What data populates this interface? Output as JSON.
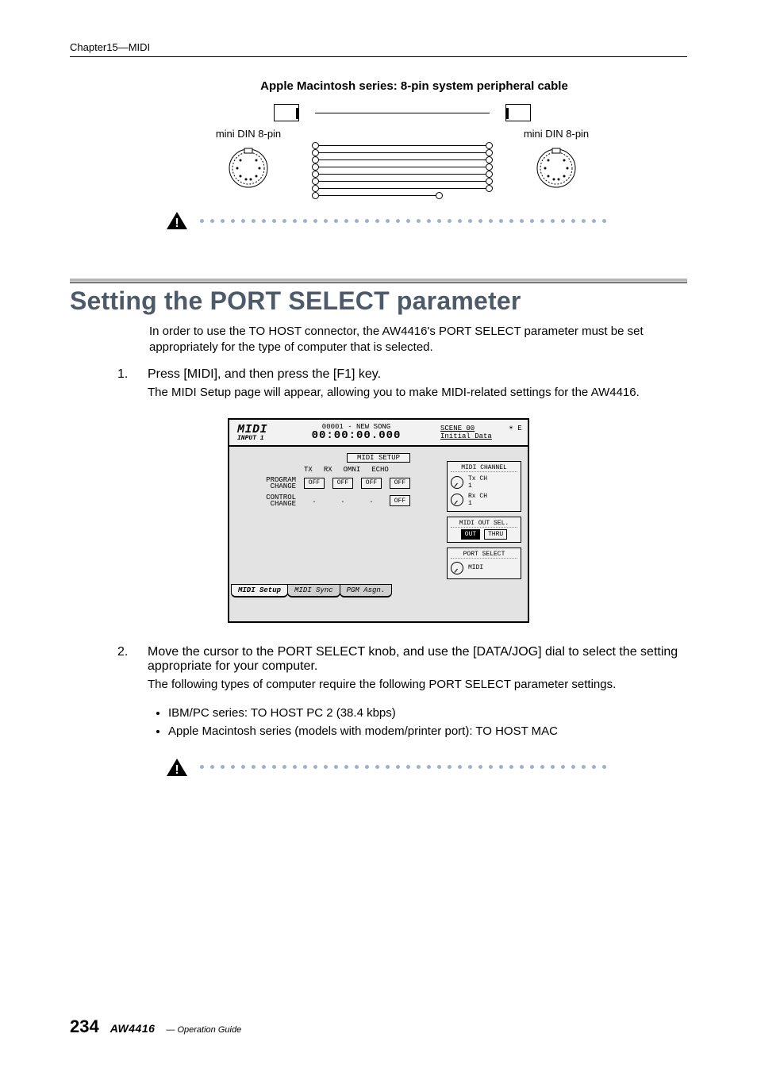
{
  "header": {
    "chapter": "Chapter15—MIDI"
  },
  "cable": {
    "title": "Apple Macintosh series: 8-pin system peripheral cable",
    "left_label": "mini DIN 8-pin",
    "right_label": "mini DIN 8-pin"
  },
  "section": {
    "title": "Setting the PORT SELECT parameter",
    "intro": "In order to use the TO HOST connector, the AW4416's PORT SELECT parameter must be set appropriately for the type of computer that is selected."
  },
  "steps": [
    {
      "num": "1.",
      "title": "Press [MIDI], and then press the [F1] key.",
      "desc": "The MIDI Setup page will appear, allowing you to make MIDI-related settings for the AW4416."
    },
    {
      "num": "2.",
      "title": "Move the cursor to the PORT SELECT knob, and use the [DATA/JOG] dial to select the setting appropriate for your computer.",
      "desc": "The following types of computer require the following PORT SELECT parameter settings.",
      "bullets": [
        "IBM/PC series: TO HOST PC 2 (38.4 kbps)",
        "Apple Macintosh series (models with modem/printer port): TO HOST MAC"
      ]
    }
  ],
  "screenshot": {
    "title_left": "MIDI",
    "title_left_sub": "INPUT 1",
    "song": "00001 - NEW SONG",
    "time": "00:00:00.000",
    "scene": "SCENE 00",
    "scene_right": "E",
    "initial": "Initial Data",
    "setup_label": "MIDI SETUP",
    "cols": [
      "TX",
      "RX",
      "OMNI",
      "ECHO"
    ],
    "rows": [
      {
        "label_lines": [
          "PROGRAM",
          "CHANGE"
        ],
        "cells": [
          "OFF",
          "OFF",
          "OFF",
          "OFF"
        ]
      },
      {
        "label_lines": [
          "CONTROL",
          "CHANGE"
        ],
        "cells": [
          ".",
          ".",
          ".",
          "OFF"
        ]
      }
    ],
    "right": {
      "channel_title": "MIDI CHANNEL",
      "tx": {
        "label": "Tx CH",
        "value": "1"
      },
      "rx": {
        "label": "Rx CH",
        "value": "1"
      },
      "out_sel_title": "MIDI OUT SEL.",
      "out_btn": "OUT",
      "thru_btn": "THRU",
      "port_select_title": "PORT SELECT",
      "port_value": "MIDI"
    },
    "tabs": [
      "MIDI Setup",
      "MIDI Sync",
      "PGM Asgn."
    ]
  },
  "footer": {
    "page": "234",
    "product": "AW4416",
    "guide": "— Operation Guide"
  }
}
